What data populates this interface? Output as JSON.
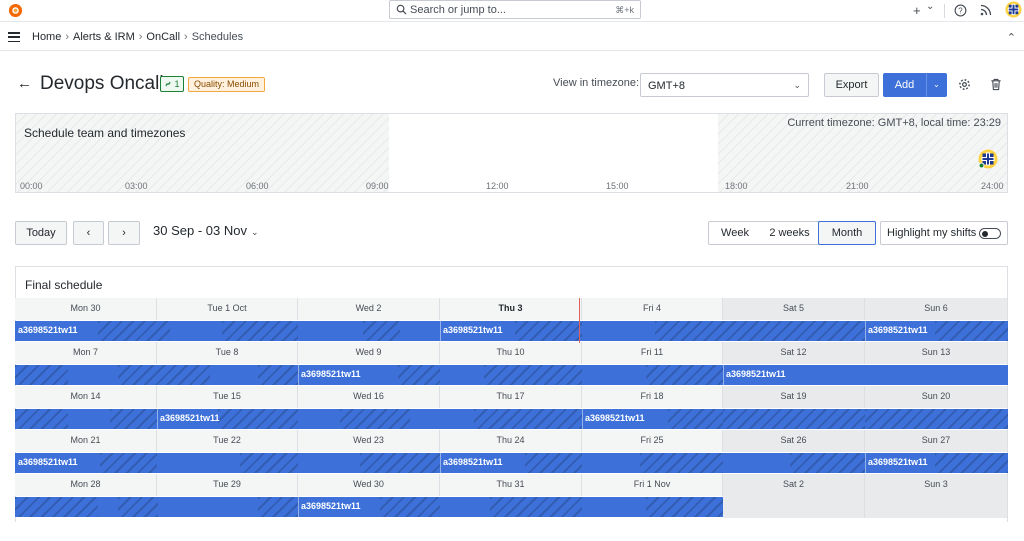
{
  "topbar": {
    "search_placeholder": "Search or jump to...",
    "search_shortcut": "⌘+k",
    "plus": "+",
    "plus_caret": "⌄",
    "help": "?",
    "rss": "≈"
  },
  "breadcrumbs": [
    "Home",
    "Alerts & IRM",
    "OnCall",
    "Schedules"
  ],
  "header": {
    "title": "Devops Oncall",
    "link_count": "1",
    "quality_badge": "Quality: Medium",
    "timezone_label": "View in timezone:",
    "timezone_value": "GMT+8",
    "export_label": "Export",
    "add_label": "Add"
  },
  "timezones_panel": {
    "title": "Schedule team and timezones",
    "current": "Current timezone: GMT+8, local time: 23:29",
    "ticks": [
      "00:00",
      "03:00",
      "06:00",
      "09:00",
      "12:00",
      "15:00",
      "18:00",
      "21:00",
      "24:00"
    ]
  },
  "controls": {
    "today": "Today",
    "prev": "‹",
    "next": "›",
    "range": "30 Sep - 03 Nov",
    "views": [
      "Week",
      "2 weeks",
      "Month"
    ],
    "active_view": "Month",
    "highlight_label": "Highlight my shifts",
    "highlight_on": false
  },
  "schedule": {
    "title": "Final schedule",
    "weeks": [
      {
        "days": [
          "Mon 30",
          "Tue 1 Oct",
          "Wed 2",
          "Thu 3",
          "Fri 4",
          "Sat 5",
          "Sun 6"
        ],
        "shifts": [
          "a3698521tw11",
          "a3698521tw11",
          "a3698521tw11"
        ]
      },
      {
        "days": [
          "Mon 7",
          "Tue 8",
          "Wed 9",
          "Thu 10",
          "Fri 11",
          "Sat 12",
          "Sun 13"
        ],
        "shifts": [
          "a3698521tw11",
          "a3698521tw11"
        ]
      },
      {
        "days": [
          "Mon 14",
          "Tue 15",
          "Wed 16",
          "Thu 17",
          "Fri 18",
          "Sat 19",
          "Sun 20"
        ],
        "shifts": [
          "a3698521tw11",
          "a3698521tw11"
        ]
      },
      {
        "days": [
          "Mon 21",
          "Tue 22",
          "Wed 23",
          "Thu 24",
          "Fri 25",
          "Sat 26",
          "Sun 27"
        ],
        "shifts": [
          "a3698521tw11",
          "a3698521tw11",
          "a3698521tw11"
        ]
      },
      {
        "days": [
          "Mon 28",
          "Tue 29",
          "Wed 30",
          "Thu 31",
          "Fri 1 Nov",
          "Sat 2",
          "Sun 3"
        ],
        "shifts": [
          "a3698521tw11"
        ]
      }
    ]
  },
  "colors": {
    "primary": "#3d71d9",
    "now_line": "#e0645a",
    "badge_green": "#1a7f37",
    "badge_orange": "#f5a742"
  }
}
